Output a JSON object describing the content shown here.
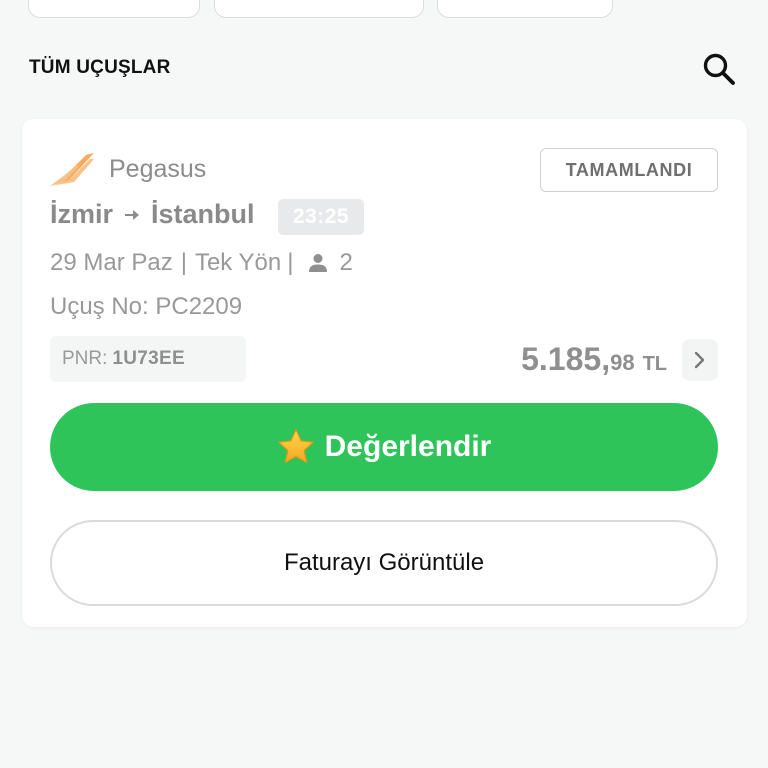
{
  "section_title": "TÜM UÇUŞLAR",
  "icons": {
    "search": "search-icon",
    "airline_logo": "pegasus-logo-icon",
    "route_arrow": "arrow-right-icon",
    "passengers": "person-icon",
    "price_chevron": "chevron-right-icon",
    "rate_star": "star-icon"
  },
  "colors": {
    "rate_button": "#2fc45a",
    "logo": "#f7a24a"
  },
  "flight": {
    "airline": "Pegasus",
    "status": "TAMAMLANDI",
    "origin": "İzmir",
    "destination": "İstanbul",
    "time": "23:25",
    "date": "29 Mar Paz",
    "separator": "|",
    "trip_type": "Tek Yön",
    "passenger_count": "2",
    "flight_number": "Uçuş No: PC2209",
    "pnr_label": "PNR:",
    "pnr_value": "1U73EE",
    "price_main": "5.185,",
    "price_decimal": "98",
    "currency": "TL"
  },
  "actions": {
    "rate_label": "Değerlendir",
    "invoice_label": "Faturayı Görüntüle"
  }
}
